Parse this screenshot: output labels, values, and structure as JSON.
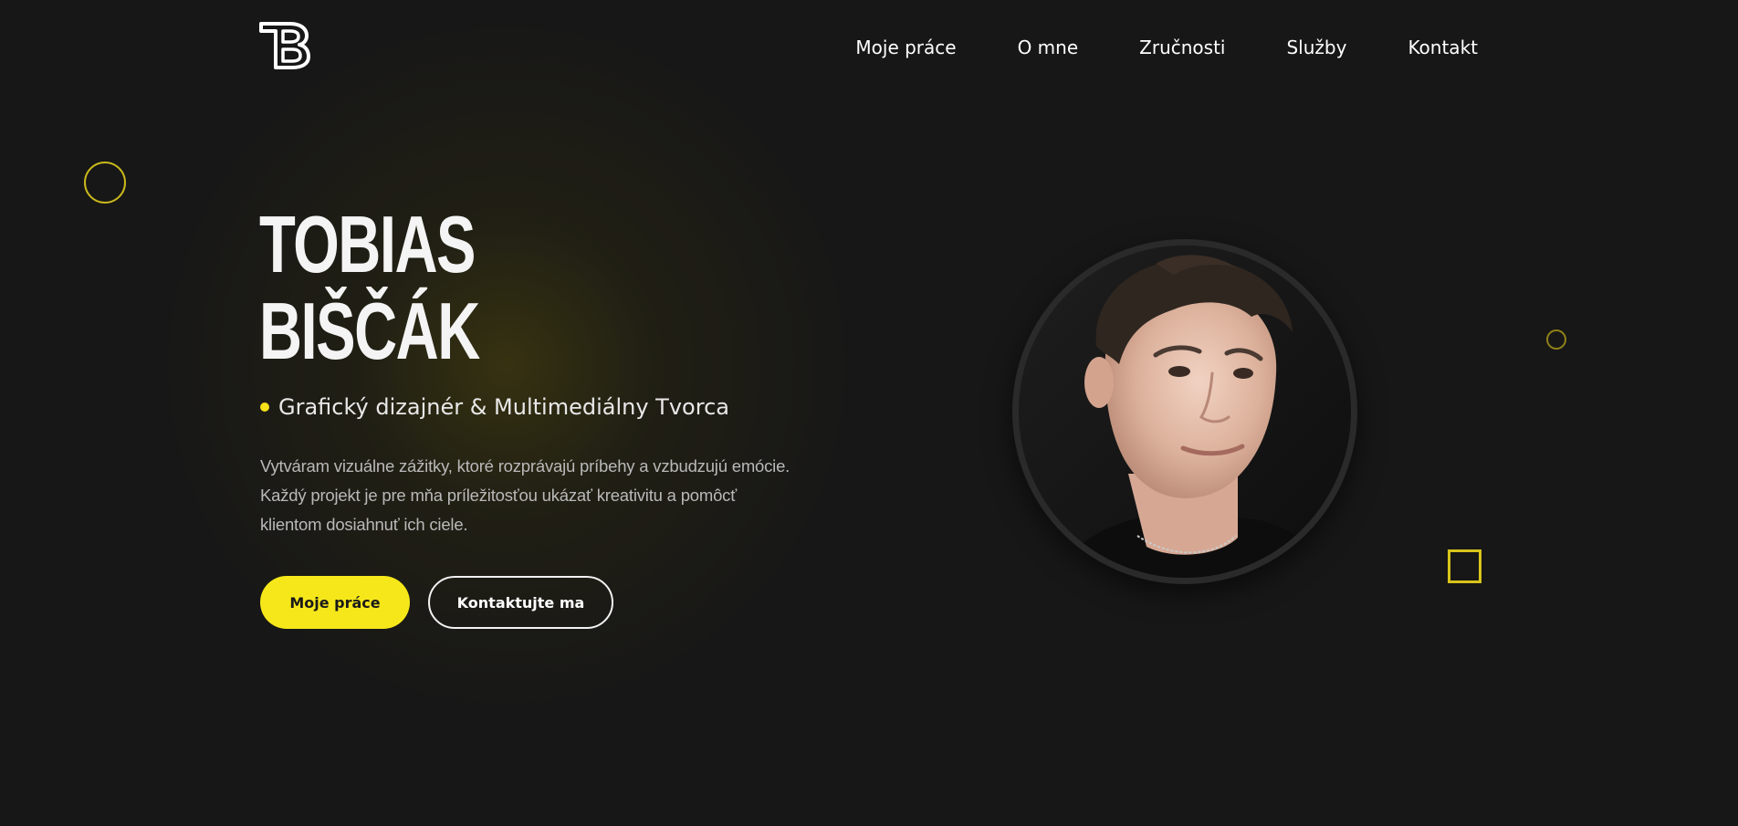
{
  "header": {
    "logo_icon": "tb-monogram-logo",
    "nav": [
      {
        "label": "Moje práce"
      },
      {
        "label": "O mne"
      },
      {
        "label": "Zručnosti"
      },
      {
        "label": "Služby"
      },
      {
        "label": "Kontakt"
      }
    ]
  },
  "hero": {
    "name_line1": "TOBIAS",
    "name_line2": "BIŠČÁK",
    "subtitle": "Grafický dizajnér & Multimediálny Tvorca",
    "description": "Vytváram vizuálne zážitky, ktoré rozprávajú príbehy a vzbudzujú emócie. Každý projekt je pre mňa príležitosťou ukázať kreativitu a pomôcť klientom dosiahnuť ich ciele.",
    "primary_button": "Moje práce",
    "secondary_button": "Kontaktujte ma",
    "portrait_icon": "profile-photo"
  },
  "colors": {
    "background": "#171717",
    "accent": "#f6e71a",
    "text": "#f2f2f2",
    "muted_text": "#b9b9b9"
  }
}
